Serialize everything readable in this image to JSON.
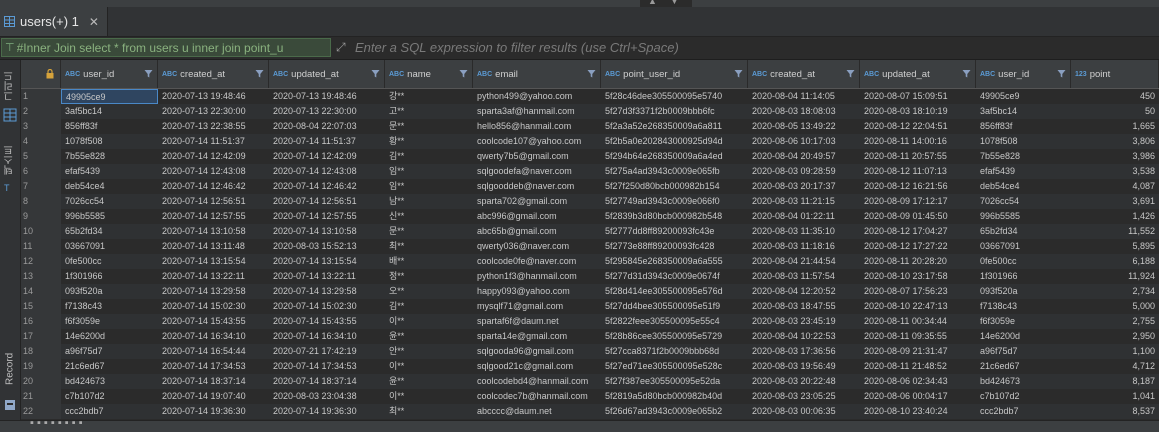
{
  "tab": {
    "label": "users(+) 1",
    "close": "✕"
  },
  "filter": {
    "query": "#Inner Join select * from users u inner join point_u",
    "placeholder": "Enter a SQL expression to filter results (use Ctrl+Space)"
  },
  "left_tabs": {
    "grid": "그리드",
    "text": "텍스트",
    "record": "Record"
  },
  "column_type_tags": {
    "text": "ABC",
    "number": "123"
  },
  "columns": [
    {
      "name": "user_id",
      "type": "text"
    },
    {
      "name": "created_at",
      "type": "text"
    },
    {
      "name": "updated_at",
      "type": "text"
    },
    {
      "name": "name",
      "type": "text"
    },
    {
      "name": "email",
      "type": "text"
    },
    {
      "name": "point_user_id",
      "type": "text"
    },
    {
      "name": "created_at",
      "type": "text"
    },
    {
      "name": "updated_at",
      "type": "text"
    },
    {
      "name": "user_id",
      "type": "text"
    },
    {
      "name": "point",
      "type": "number"
    }
  ],
  "rows": [
    [
      "1",
      "49905ce9",
      "2020-07-13 19:48:46",
      "2020-07-13 19:48:46",
      "강**",
      "python499@yahoo.com",
      "5f28c46dee305500095e5740",
      "2020-08-04 11:14:05",
      "2020-08-07 15:09:51",
      "49905ce9",
      "450"
    ],
    [
      "2",
      "3af5bc14",
      "2020-07-13 22:30:00",
      "2020-07-13 22:30:00",
      "고**",
      "sparta3af@hanmail.com",
      "5f27d3f3371f2b0009bbb6fc",
      "2020-08-03 18:08:03",
      "2020-08-03 18:10:19",
      "3af5bc14",
      "50"
    ],
    [
      "3",
      "856ff83f",
      "2020-07-13 22:38:55",
      "2020-08-04 22:07:03",
      "문**",
      "hello856@hanmail.com",
      "5f2a3a52e268350009a6a811",
      "2020-08-05 13:49:22",
      "2020-08-12 22:04:51",
      "856ff83f",
      "1,665"
    ],
    [
      "4",
      "1078f508",
      "2020-07-14 11:51:37",
      "2020-07-14 11:51:37",
      "황**",
      "coolcode107@yahoo.com",
      "5f2b5a0e202843000925d94d",
      "2020-08-06 10:17:03",
      "2020-08-11 14:00:16",
      "1078f508",
      "3,806"
    ],
    [
      "5",
      "7b55e828",
      "2020-07-14 12:42:09",
      "2020-07-14 12:42:09",
      "김**",
      "qwerty7b5@gmail.com",
      "5f294b64e268350009a6a4ed",
      "2020-08-04 20:49:57",
      "2020-08-11 20:57:55",
      "7b55e828",
      "3,986"
    ],
    [
      "6",
      "efaf5439",
      "2020-07-14 12:43:08",
      "2020-07-14 12:43:08",
      "임**",
      "sqlgoodefa@naver.com",
      "5f275a4ad3943c0009e065fb",
      "2020-08-03 09:28:59",
      "2020-08-12 11:07:13",
      "efaf5439",
      "3,538"
    ],
    [
      "7",
      "deb54ce4",
      "2020-07-14 12:46:42",
      "2020-07-14 12:46:42",
      "임**",
      "sqlgooddeb@naver.com",
      "5f27f250d80bcb000982b154",
      "2020-08-03 20:17:37",
      "2020-08-12 16:21:56",
      "deb54ce4",
      "4,087"
    ],
    [
      "8",
      "7026cc54",
      "2020-07-14 12:56:51",
      "2020-07-14 12:56:51",
      "남**",
      "sparta702@gmail.com",
      "5f27749ad3943c0009e066f0",
      "2020-08-03 11:21:15",
      "2020-08-09 17:12:17",
      "7026cc54",
      "3,691"
    ],
    [
      "9",
      "996b5585",
      "2020-07-14 12:57:55",
      "2020-07-14 12:57:55",
      "신**",
      "abc996@gmail.com",
      "5f2839b3d80bcb000982b548",
      "2020-08-04 01:22:11",
      "2020-08-09 01:45:50",
      "996b5585",
      "1,426"
    ],
    [
      "10",
      "65b2fd34",
      "2020-07-14 13:10:58",
      "2020-07-14 13:10:58",
      "문**",
      "abc65b@gmail.com",
      "5f2777dd8ff89200093fc43e",
      "2020-08-03 11:35:10",
      "2020-08-12 17:04:27",
      "65b2fd34",
      "11,552"
    ],
    [
      "11",
      "03667091",
      "2020-07-14 13:11:48",
      "2020-08-03 15:52:13",
      "최**",
      "qwerty036@naver.com",
      "5f2773e88ff89200093fc428",
      "2020-08-03 11:18:16",
      "2020-08-12 17:27:22",
      "03667091",
      "5,895"
    ],
    [
      "12",
      "0fe500cc",
      "2020-07-14 13:15:54",
      "2020-07-14 13:15:54",
      "배**",
      "coolcode0fe@naver.com",
      "5f295845e268350009a6a555",
      "2020-08-04 21:44:54",
      "2020-08-11 20:28:20",
      "0fe500cc",
      "6,188"
    ],
    [
      "13",
      "1f301966",
      "2020-07-14 13:22:11",
      "2020-07-14 13:22:11",
      "정**",
      "python1f3@hanmail.com",
      "5f277d31d3943c0009e0674f",
      "2020-08-03 11:57:54",
      "2020-08-10 23:17:58",
      "1f301966",
      "11,924"
    ],
    [
      "14",
      "093f520a",
      "2020-07-14 13:29:58",
      "2020-07-14 13:29:58",
      "오**",
      "happy093@yahoo.com",
      "5f28d414ee305500095e576d",
      "2020-08-04 12:20:52",
      "2020-08-07 17:56:23",
      "093f520a",
      "2,734"
    ],
    [
      "15",
      "f7138c43",
      "2020-07-14 15:02:30",
      "2020-07-14 15:02:30",
      "김**",
      "mysqlf71@gmail.com",
      "5f27dd4bee305500095e51f9",
      "2020-08-03 18:47:55",
      "2020-08-10 22:47:13",
      "f7138c43",
      "5,000"
    ],
    [
      "16",
      "f6f3059e",
      "2020-07-14 15:43:55",
      "2020-07-14 15:43:55",
      "이**",
      "spartaf6f@daum.net",
      "5f2822feee305500095e55c4",
      "2020-08-03 23:45:19",
      "2020-08-11 00:34:44",
      "f6f3059e",
      "2,755"
    ],
    [
      "17",
      "14e6200d",
      "2020-07-14 16:34:10",
      "2020-07-14 16:34:10",
      "윤**",
      "sparta14e@gmail.com",
      "5f28b86cee305500095e5729",
      "2020-08-04 10:22:53",
      "2020-08-11 09:35:55",
      "14e6200d",
      "2,950"
    ],
    [
      "18",
      "a96f75d7",
      "2020-07-14 16:54:44",
      "2020-07-21 17:42:19",
      "안**",
      "sqlgooda96@gmail.com",
      "5f27cca8371f2b0009bbb68d",
      "2020-08-03 17:36:56",
      "2020-08-09 21:31:47",
      "a96f75d7",
      "1,100"
    ],
    [
      "19",
      "21c6ed67",
      "2020-07-14 17:34:53",
      "2020-07-14 17:34:53",
      "이**",
      "sqlgood21c@gmail.com",
      "5f27ed71ee305500095e528c",
      "2020-08-03 19:56:49",
      "2020-08-11 21:48:52",
      "21c6ed67",
      "4,712"
    ],
    [
      "20",
      "bd424673",
      "2020-07-14 18:37:14",
      "2020-07-14 18:37:14",
      "윤**",
      "coolcodebd4@hanmail.com",
      "5f27f387ee305500095e52da",
      "2020-08-03 20:22:48",
      "2020-08-06 02:34:43",
      "bd424673",
      "8,187"
    ],
    [
      "21",
      "c7b107d2",
      "2020-07-14 19:07:40",
      "2020-08-03 23:04:38",
      "이**",
      "coolcodec7b@hanmail.com",
      "5f2819a5d80bcb000982b40d",
      "2020-08-03 23:05:25",
      "2020-08-06 00:04:17",
      "c7b107d2",
      "1,041"
    ],
    [
      "22",
      "ccc2bdb7",
      "2020-07-14 19:36:30",
      "2020-07-14 19:36:30",
      "최**",
      "abcccc@daum.net",
      "5f26d67ad3943c0009e065b2",
      "2020-08-03 00:06:35",
      "2020-08-10 23:40:24",
      "ccc2bdb7",
      "8,537"
    ]
  ],
  "colors": {
    "accent": "#5b9bd5",
    "selection": "#4a88c7",
    "query_text": "#8ab27f"
  }
}
